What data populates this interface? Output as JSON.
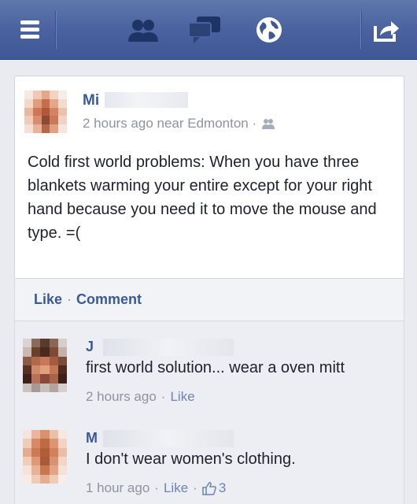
{
  "topbar": {
    "icons": [
      "menu-icon",
      "friends-icon",
      "messages-icon",
      "globe-icon",
      "share-icon"
    ]
  },
  "post": {
    "author_initial": "Mi",
    "time": "2 hours ago near Edmonton ·",
    "text": "Cold first world problems: When you have three blankets warming your entire except for your right hand because you need it to move the mouse and type. =("
  },
  "actions": {
    "like": "Like",
    "separator": "·",
    "comment": "Comment"
  },
  "comments": [
    {
      "author_initial": "J",
      "text": "first world solution... wear a oven mitt",
      "time": "2 hours ago",
      "separator": "·",
      "like": "Like"
    },
    {
      "author_initial": "M",
      "text": "I don't wear women's clothing.",
      "time": "1 hour ago",
      "separator": "·",
      "like": "Like",
      "separator2": "·",
      "like_count": "3"
    }
  ],
  "colors": {
    "topbar": "#4a63a0",
    "link": "#3b5998",
    "meta": "#8d949e"
  }
}
